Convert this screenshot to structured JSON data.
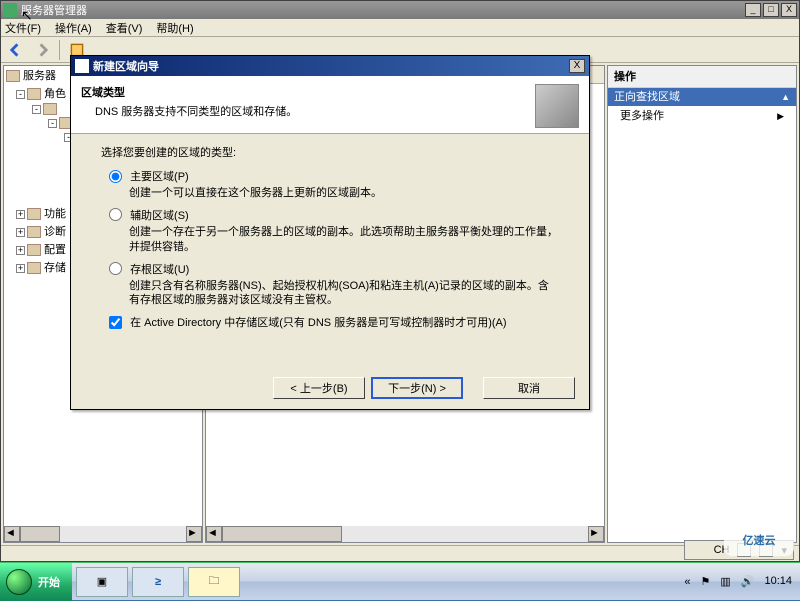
{
  "mmc": {
    "title": "服务器管理器",
    "menus": {
      "file": "文件(F)",
      "action": "操作(A)",
      "view": "查看(V)",
      "help": "帮助(H)"
    },
    "tree": {
      "root": "服务器",
      "roles": "角色",
      "n1": "",
      "n2": "功能",
      "n3": "诊断",
      "n4": "配置",
      "n5": "存储"
    },
    "actions": {
      "title": "操作",
      "selected": "正向查找区域",
      "more": "更多操作"
    }
  },
  "wizard": {
    "title": "新建区域向导",
    "header_title": "区域类型",
    "header_sub": "DNS 服务器支持不同类型的区域和存储。",
    "prompt": "选择您要创建的区域的类型:",
    "opt1": {
      "label": "主要区域(P)",
      "desc": "创建一个可以直接在这个服务器上更新的区域副本。"
    },
    "opt2": {
      "label": "辅助区域(S)",
      "desc": "创建一个存在于另一个服务器上的区域的副本。此选项帮助主服务器平衡处理的工作量，并提供容错。"
    },
    "opt3": {
      "label": "存根区域(U)",
      "desc": "创建只含有名称服务器(NS)、起始授权机构(SOA)和粘连主机(A)记录的区域的副本。含有存根区域的服务器对该区域没有主管权。"
    },
    "opt4": {
      "label": "在 Active Directory 中存储区域(只有 DNS 服务器是可写域控制器时才可用)(A)"
    },
    "buttons": {
      "back": "< 上一步(B)",
      "next": "下一步(N) >",
      "cancel": "取消"
    }
  },
  "langbar": {
    "ch": "CH"
  },
  "taskbar": {
    "start": "开始",
    "time": "10:14",
    "date": "  "
  },
  "watermark": "亿速云"
}
